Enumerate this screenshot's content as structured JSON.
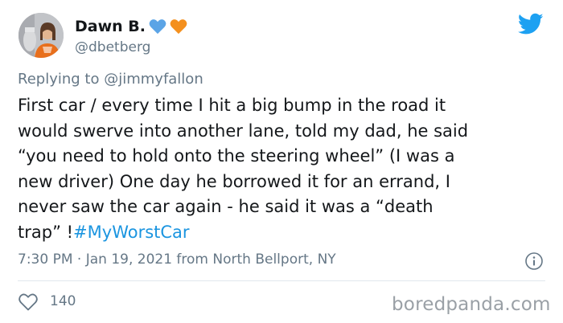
{
  "author": {
    "display_name": "Dawn B.",
    "username": "@dbetberg"
  },
  "reply": {
    "prefix": "Replying to",
    "handle": "@jimmyfallon"
  },
  "tweet": {
    "text": "First car / every time I hit a big bump in the road it\nwould swerve into another lane, told my dad, he said\n“you need to hold onto the steering wheel” (I was a\nnew driver) One day he borrowed it for an errand, I\nnever saw the car again - he said it was a “death\ntrap” !",
    "hashtag": "#MyWorstCar"
  },
  "meta": {
    "timestamp": "7:30 PM · Jan 19, 2021 from North Bellport, NY"
  },
  "stats": {
    "likes": "140"
  },
  "watermark": "boredpanda.com",
  "colors": {
    "twitter_blue": "#1da1f2",
    "hashtag": "#1b95e0",
    "heart_blue": "#5ba4e6",
    "heart_orange": "#f4901e",
    "secondary_text": "#657786",
    "divider": "#e1e8ed"
  },
  "icons": {
    "logo": "twitter-bird-icon",
    "info": "info-icon",
    "like": "heart-outline-icon",
    "emoji_1": "blue-heart-icon",
    "emoji_2": "orange-heart-icon"
  }
}
